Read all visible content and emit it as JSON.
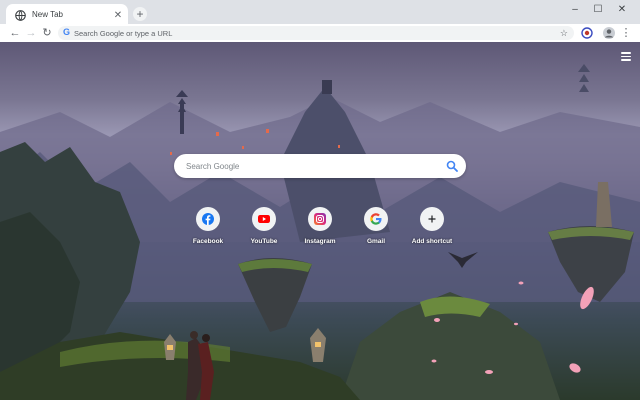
{
  "tab": {
    "title": "New Tab",
    "close": "✕",
    "new_tab": "+"
  },
  "window_controls": {
    "minimize": "–",
    "maximize": "☐",
    "close": "✕"
  },
  "toolbar": {
    "back": "←",
    "forward": "→",
    "reload": "↻",
    "omnibox_placeholder": "Search Google or type a URL",
    "bookmark_star": "☆",
    "menu": "⋮"
  },
  "ntp": {
    "search_placeholder": "Search Google",
    "shortcuts": [
      {
        "label": "Facebook",
        "icon": "facebook-icon",
        "color": "#1877f2"
      },
      {
        "label": "YouTube",
        "icon": "youtube-icon",
        "color": "#ff0000"
      },
      {
        "label": "Instagram",
        "icon": "instagram-icon",
        "color": "#c13584"
      },
      {
        "label": "Gmail",
        "icon": "google-icon",
        "color": "#4285f4"
      },
      {
        "label": "Add shortcut",
        "icon": "plus-icon",
        "color": "#202124"
      }
    ]
  }
}
